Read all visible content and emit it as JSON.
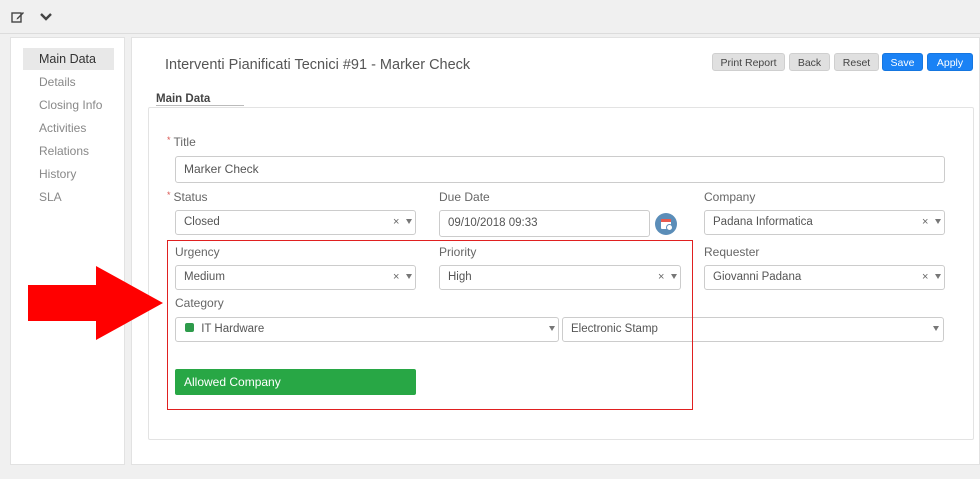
{
  "toolbar": {
    "icons": [
      "edit-icon",
      "chevron-down-icon"
    ]
  },
  "sidebar": {
    "items": [
      {
        "label": "Main Data"
      },
      {
        "label": "Details"
      },
      {
        "label": "Closing Info"
      },
      {
        "label": "Activities"
      },
      {
        "label": "Relations"
      },
      {
        "label": "History"
      },
      {
        "label": "SLA"
      }
    ]
  },
  "header": {
    "title": "Interventi Pianificati Tecnici #91 - Marker Check"
  },
  "actions": {
    "print": "Print Report",
    "back": "Back",
    "reset": "Reset",
    "save": "Save",
    "apply": "Apply"
  },
  "section": {
    "label": "Main Data"
  },
  "form": {
    "title": {
      "label": "Title",
      "value": "Marker Check",
      "required": "*"
    },
    "status": {
      "label": "Status",
      "value": "Closed",
      "required": "*",
      "clear": "×"
    },
    "due_date": {
      "label": "Due Date",
      "value": "09/10/2018 09:33"
    },
    "company": {
      "label": "Company",
      "value": "Padana Informatica",
      "clear": "×"
    },
    "urgency": {
      "label": "Urgency",
      "value": "Medium",
      "clear": "×"
    },
    "priority": {
      "label": "Priority",
      "value": "High",
      "clear": "×"
    },
    "requester": {
      "label": "Requester",
      "value": "Giovanni Padana",
      "clear": "×"
    },
    "category": {
      "label": "Category",
      "value": "IT Hardware",
      "sub_value": "Electronic Stamp"
    },
    "allowed_company": {
      "label": "Allowed Company"
    }
  },
  "colors": {
    "accent": "#1a82f5",
    "success": "#28a745",
    "highlight": "#e02020"
  }
}
